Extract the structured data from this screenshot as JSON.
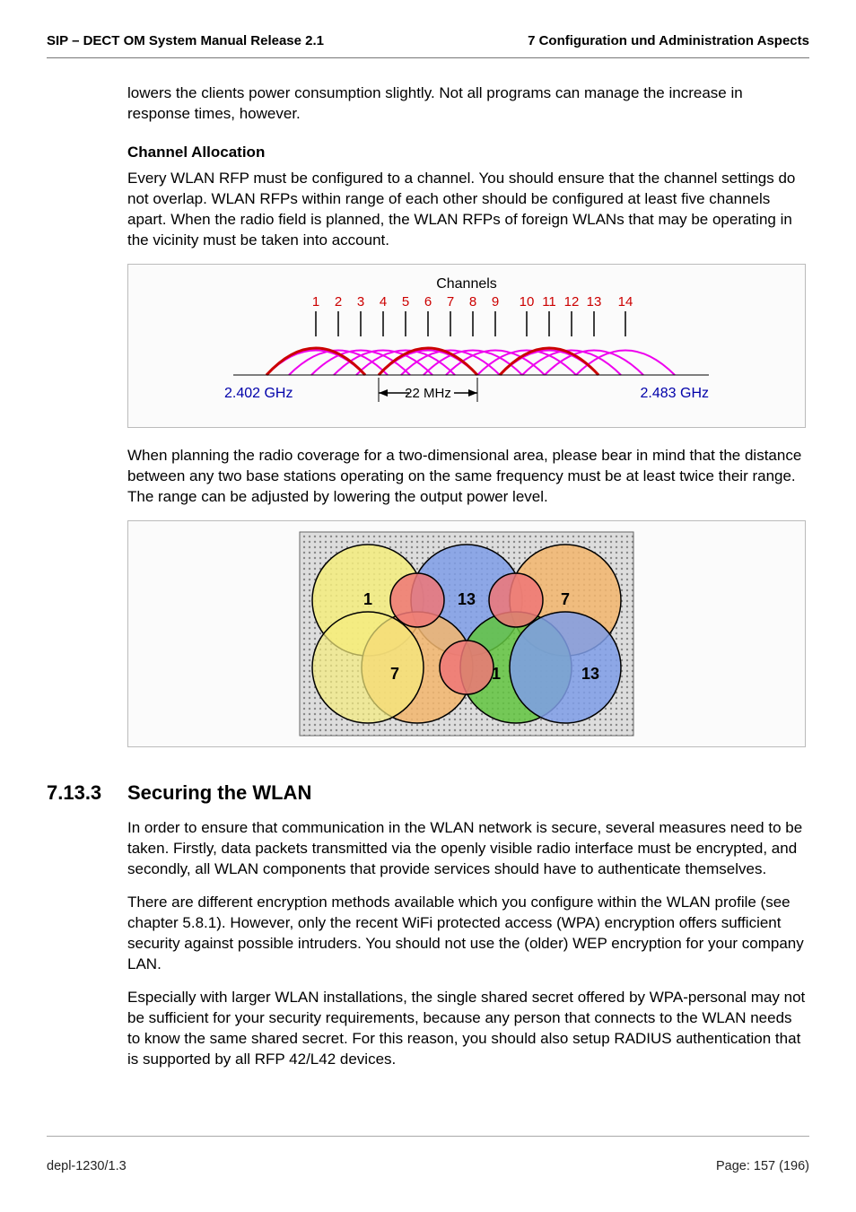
{
  "header": {
    "left": "SIP – DECT OM System Manual Release 2.1",
    "right": "7 Configuration und Administration Aspects"
  },
  "paragraphs": {
    "intro_continuation": "lowers the clients power consumption slightly. Not all programs can manage the increase in response times, however.",
    "channel_allocation_heading": "Channel Allocation",
    "channel_allocation_body": "Every WLAN RFP must be configured to a channel. You should ensure that the channel settings do not overlap. WLAN RFPs within range of each other should be configured at least five channels apart. When the radio field is planned, the WLAN RFPs of foreign WLANs that may be operating in the vicinity must be taken into account.",
    "planning_body": "When planning the radio coverage for a two-dimensional area, please bear in mind that the distance between any two base stations operating on the same frequency must be at least twice their range. The range can be adjusted by lowering the output power level.",
    "securing_p1": "In order to ensure that communication in the WLAN network is secure, several measures need to be taken. Firstly, data packets transmitted via the openly visible radio interface must be encrypted, and secondly, all WLAN components that provide services should have to authenticate themselves.",
    "securing_p2": "There are different encryption methods available which you configure within the WLAN profile (see chapter 5.8.1). However, only the recent WiFi protected access (WPA) encryption offers sufficient security against possible intruders. You should not use the (older) WEP encryption for your company LAN.",
    "securing_p3": "Especially with larger WLAN installations, the single shared secret offered by WPA-personal may not be sufficient for your security requirements, because any person that connects to the WLAN needs to know the same shared secret. For this reason, you should also setup RADIUS authentication that is supported by all RFP 42/L42 devices."
  },
  "section": {
    "number": "7.13.3",
    "title": "Securing the WLAN"
  },
  "footer": {
    "left": "depl-1230/1.3",
    "right": "Page: 157 (196)"
  },
  "fig1": {
    "title": "Channels",
    "channels": [
      "1",
      "2",
      "3",
      "4",
      "5",
      "6",
      "7",
      "8",
      "9",
      "10",
      "11",
      "12",
      "13",
      "14"
    ],
    "left_freq": "2.402 GHz",
    "right_freq": "2.483 GHz",
    "bandwidth": "22 MHz"
  },
  "fig2": {
    "cells": [
      "1",
      "13",
      "7",
      "7",
      "1",
      "13"
    ]
  }
}
